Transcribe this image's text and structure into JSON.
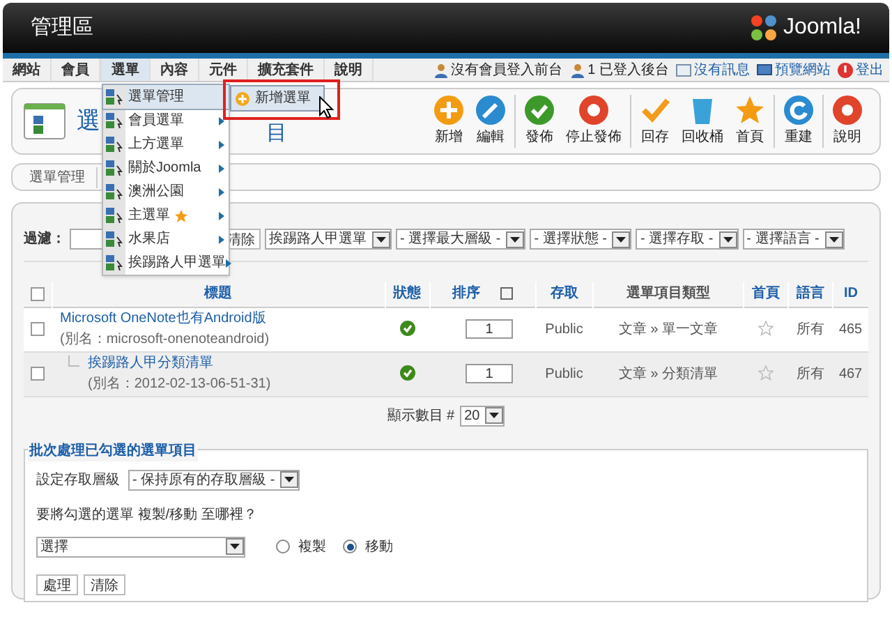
{
  "header": {
    "title": "管理區",
    "logo_text": "Joomla!"
  },
  "nav": {
    "tabs": [
      {
        "label": "網站",
        "selected": false
      },
      {
        "label": "會員",
        "selected": false
      },
      {
        "label": "選單",
        "selected": true
      },
      {
        "label": "內容",
        "selected": false
      },
      {
        "label": "元件",
        "selected": false
      },
      {
        "label": "擴充套件",
        "selected": false
      },
      {
        "label": "說明",
        "selected": false
      }
    ],
    "status": [
      {
        "kind": "users",
        "label": "沒有會員登入前台"
      },
      {
        "kind": "admins",
        "label": "1 已登入後台"
      },
      {
        "kind": "mail",
        "label": "沒有訊息"
      },
      {
        "kind": "preview",
        "label": "預覽網站"
      },
      {
        "kind": "logout",
        "label": "登出"
      }
    ]
  },
  "toolbar": {
    "title_parts": [
      "選",
      "目"
    ],
    "groups": [
      [
        {
          "kind": "new",
          "label": "新增"
        },
        {
          "kind": "edit",
          "label": "編輯"
        }
      ],
      [
        {
          "kind": "publish",
          "label": "發佈"
        },
        {
          "kind": "unpublish",
          "label": "停止發佈"
        }
      ],
      [
        {
          "kind": "checkin",
          "label": "回存"
        },
        {
          "kind": "trash",
          "label": "回收桶"
        },
        {
          "kind": "home",
          "label": "首頁"
        }
      ],
      [
        {
          "kind": "rebuild",
          "label": "重建"
        }
      ],
      [
        {
          "kind": "help",
          "label": "說明"
        }
      ]
    ]
  },
  "menu_dropdown": {
    "items": [
      {
        "label": "選單管理",
        "selected": true,
        "has_submenu": false,
        "home": false
      },
      {
        "label": "會員選單",
        "selected": false,
        "has_submenu": true,
        "home": false
      },
      {
        "label": "上方選單",
        "selected": false,
        "has_submenu": true,
        "home": false
      },
      {
        "label": "關於Joomla",
        "selected": false,
        "has_submenu": true,
        "home": false
      },
      {
        "label": "澳洲公園",
        "selected": false,
        "has_submenu": true,
        "home": false
      },
      {
        "label": "主選單",
        "selected": false,
        "has_submenu": true,
        "home": true
      },
      {
        "label": "水果店",
        "selected": false,
        "has_submenu": true,
        "home": false
      },
      {
        "label": "挨踢路人甲選單",
        "selected": false,
        "has_submenu": true,
        "home": false
      }
    ],
    "submenu": {
      "label": "新增選單",
      "highlighted": true
    }
  },
  "submenu_bar": {
    "items": [
      "選單管理"
    ]
  },
  "filter": {
    "label": "過濾：",
    "clear": "清除",
    "selects": [
      "挨踢路人甲選單",
      "- 選擇最大層級 -",
      "- 選擇狀態 -",
      "- 選擇存取 -",
      "- 選擇語言 -"
    ]
  },
  "table": {
    "all_checked": false,
    "columns": [
      "標題",
      "狀態",
      "排序",
      "存取",
      "選單項目類型",
      "首頁",
      "語言",
      "ID"
    ],
    "rows": [
      {
        "kind": "top",
        "title": "Microsoft OneNote也有Android版",
        "alias": "(別名：microsoft-onenoteandroid)",
        "checked": false,
        "published": true,
        "order": "1",
        "access": "Public",
        "type": "文章 » 單一文章",
        "home": false,
        "language": "所有",
        "id": "465"
      },
      {
        "kind": "sub",
        "title": "挨踢路人甲分類清單",
        "alias": "(別名：2012-02-13-06-51-31)",
        "checked": false,
        "published": true,
        "order": "1",
        "access": "Public",
        "type": "文章 » 分類清單",
        "home": false,
        "language": "所有",
        "id": "467"
      }
    ]
  },
  "pagination": {
    "label": "顯示數目 #",
    "value": "20"
  },
  "batch": {
    "legend": "批次處理已勾選的選單項目",
    "access_label": "設定存取層級",
    "access_value": "- 保持原有的存取層級 -",
    "question": "要將勾選的選單 複製/移動 至哪裡？",
    "target_value": "選擇",
    "options": [
      {
        "label": "複製",
        "selected": false
      },
      {
        "label": "移動",
        "selected": true
      }
    ],
    "buttons": [
      "處理",
      "清除"
    ]
  }
}
